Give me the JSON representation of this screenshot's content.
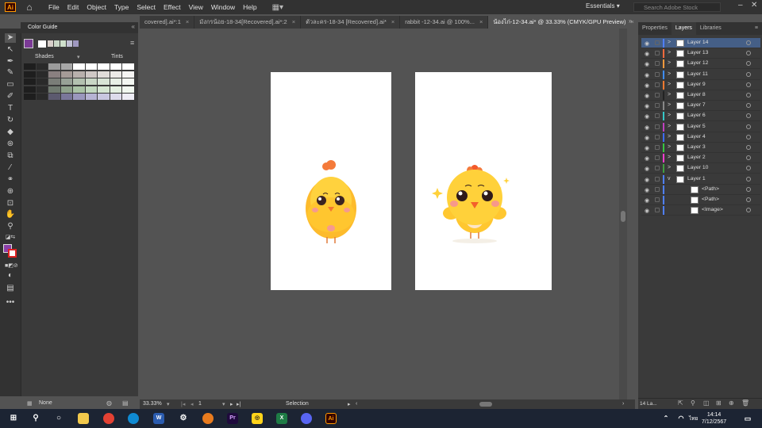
{
  "app": {
    "logo": "Ai",
    "menus": [
      "File",
      "Edit",
      "Object",
      "Type",
      "Select",
      "Effect",
      "View",
      "Window",
      "Help"
    ],
    "workspace": "Essentials",
    "search_placeholder": "Search Adobe Stock"
  },
  "tabs": [
    {
      "label": "covered].ai*:1",
      "active": false
    },
    {
      "label": "มังกรน้อย-18-34[Recovered].ai*:2",
      "active": false
    },
    {
      "label": "ตัวละคร-18-34 [Recovered].ai*",
      "active": false
    },
    {
      "label": "rabbit -12-34.ai @ 100%...",
      "active": false
    },
    {
      "label": "น้องไก่-12-34.ai* @ 33.33% (CMYK/GPU Preview)",
      "active": true
    }
  ],
  "color_guide": {
    "title": "Color Guide",
    "shades_label": "Shades",
    "tints_label": "Tints"
  },
  "status": {
    "zoom": "33.33%",
    "page": "1",
    "tool": "Selection",
    "brush": "None"
  },
  "right_panel": {
    "tabs": [
      "Properties",
      "Layers",
      "Libraries"
    ],
    "active_tab": "Layers",
    "layers": [
      {
        "name": "Layer 14",
        "color": "#4f7fff",
        "selected": true,
        "arrow": ">"
      },
      {
        "name": "Layer 13",
        "color": "#ff6a3d",
        "arrow": ">"
      },
      {
        "name": "Layer 12",
        "color": "#ff9a3d",
        "arrow": ">"
      },
      {
        "name": "Layer 11",
        "color": "#3d8cff",
        "arrow": ">"
      },
      {
        "name": "Layer 9",
        "color": "#ff7a30",
        "arrow": ">"
      },
      {
        "name": "Layer 8",
        "color": "#222222",
        "arrow": ">"
      },
      {
        "name": "Layer 7",
        "color": "#888888",
        "arrow": ">"
      },
      {
        "name": "Layer 6",
        "color": "#36c8c8",
        "arrow": ">"
      },
      {
        "name": "Layer 5",
        "color": "#c040c0",
        "arrow": ">"
      },
      {
        "name": "Layer 4",
        "color": "#3d6cff",
        "arrow": ">"
      },
      {
        "name": "Layer 3",
        "color": "#36c840",
        "arrow": ">"
      },
      {
        "name": "Layer 2",
        "color": "#ff3dd0",
        "arrow": ">"
      },
      {
        "name": "Layer 10",
        "color": "#40a040",
        "arrow": ">"
      },
      {
        "name": "Layer 1",
        "color": "#4f7fff",
        "arrow": "v"
      },
      {
        "name": "<Path>",
        "color": "#4f7fff",
        "arrow": ""
      },
      {
        "name": "<Path>",
        "color": "#4f7fff",
        "arrow": ""
      },
      {
        "name": "<Image>",
        "color": "#4f7fff",
        "arrow": ""
      }
    ],
    "layer_count": "14 La..."
  },
  "taskbar": {
    "time": "14:14",
    "date": "7/12/2567",
    "lang": "ไทย"
  }
}
